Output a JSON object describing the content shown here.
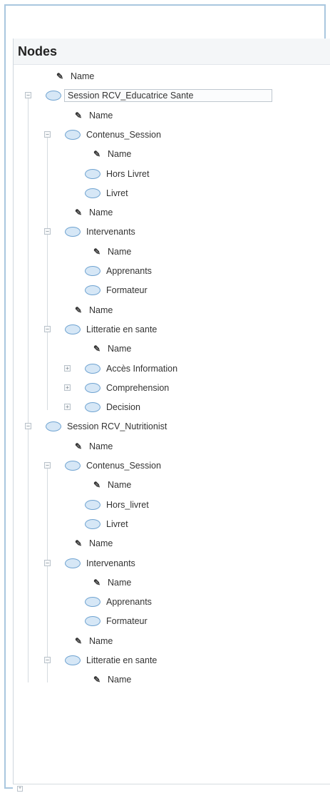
{
  "panel": {
    "title": "Nodes",
    "items": [
      {
        "type": "attr",
        "depth": 0,
        "label": "Name"
      },
      {
        "type": "node",
        "depth": 0,
        "label": "Session RCV_Educatrice Sante",
        "expander": "−",
        "selected": true
      },
      {
        "type": "attr",
        "depth": 1,
        "label": "Name"
      },
      {
        "type": "node",
        "depth": 1,
        "label": "Contenus_Session",
        "expander": "−"
      },
      {
        "type": "attr",
        "depth": 2,
        "label": "Name"
      },
      {
        "type": "node",
        "depth": 2,
        "label": "Hors Livret"
      },
      {
        "type": "node",
        "depth": 2,
        "label": "Livret"
      },
      {
        "type": "attr",
        "depth": 1,
        "label": "Name"
      },
      {
        "type": "node",
        "depth": 1,
        "label": "Intervenants",
        "expander": "−"
      },
      {
        "type": "attr",
        "depth": 2,
        "label": "Name"
      },
      {
        "type": "node",
        "depth": 2,
        "label": "Apprenants"
      },
      {
        "type": "node",
        "depth": 2,
        "label": "Formateur"
      },
      {
        "type": "attr",
        "depth": 1,
        "label": "Name"
      },
      {
        "type": "node",
        "depth": 1,
        "label": "Litteratie en sante",
        "expander": "−"
      },
      {
        "type": "attr",
        "depth": 2,
        "label": "Name"
      },
      {
        "type": "node",
        "depth": 2,
        "label": "Accès Information",
        "expander": "+"
      },
      {
        "type": "node",
        "depth": 2,
        "label": "Comprehension",
        "expander": "+"
      },
      {
        "type": "node",
        "depth": 2,
        "label": "Decision",
        "expander": "+"
      },
      {
        "type": "node",
        "depth": 0,
        "label": "Session RCV_Nutritionist",
        "expander": "−"
      },
      {
        "type": "attr",
        "depth": 1,
        "label": "Name"
      },
      {
        "type": "node",
        "depth": 1,
        "label": "Contenus_Session",
        "expander": "−"
      },
      {
        "type": "attr",
        "depth": 2,
        "label": "Name"
      },
      {
        "type": "node",
        "depth": 2,
        "label": "Hors_livret"
      },
      {
        "type": "node",
        "depth": 2,
        "label": "Livret"
      },
      {
        "type": "attr",
        "depth": 1,
        "label": "Name"
      },
      {
        "type": "node",
        "depth": 1,
        "label": "Intervenants",
        "expander": "−"
      },
      {
        "type": "attr",
        "depth": 2,
        "label": "Name"
      },
      {
        "type": "node",
        "depth": 2,
        "label": "Apprenants"
      },
      {
        "type": "node",
        "depth": 2,
        "label": "Formateur"
      },
      {
        "type": "attr",
        "depth": 1,
        "label": "Name"
      },
      {
        "type": "node",
        "depth": 1,
        "label": "Litteratie en sante",
        "expander": "−"
      },
      {
        "type": "attr",
        "depth": 2,
        "label": "Name"
      }
    ]
  },
  "footer": {
    "expander": "+"
  },
  "colors": {
    "frame_border": "#a9c7df",
    "node_fill": "#d6e7f6",
    "node_stroke": "#6fa3d1"
  },
  "icons": {
    "attribute": "attribute-pin-icon",
    "node": "node-ellipse-icon"
  }
}
